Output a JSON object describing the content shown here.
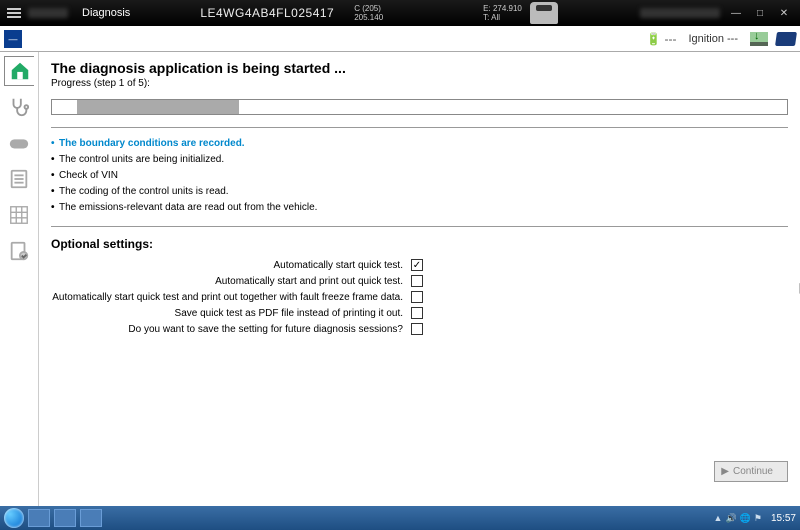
{
  "titlebar": {
    "app_name": "Diagnosis",
    "vin": "LE4WG4AB4FL025417",
    "col1a": "C (205)",
    "col1b": "205.140",
    "col2a": "E: 274.910",
    "col2b": "T: All",
    "min": "—",
    "max": "□",
    "close": "✕"
  },
  "toolbar": {
    "home": "—",
    "battery": "🔋 ---",
    "ignition": "Ignition ---"
  },
  "content": {
    "heading": "The diagnosis application is being started ...",
    "progress_label": "Progress (step 1 of 5):",
    "steps": [
      "The boundary conditions are recorded.",
      "The control units are being initialized.",
      "Check of VIN",
      "The coding of the control units is read.",
      "The emissions-relevant data are read out from the vehicle."
    ],
    "optional_heading": "Optional settings:",
    "options": [
      {
        "label": "Automatically start quick test.",
        "checked": true
      },
      {
        "label": "Automatically start and print out quick test.",
        "checked": false
      },
      {
        "label": "Automatically start quick test and print out together with fault freeze frame data.",
        "checked": false
      },
      {
        "label": "Save quick test as PDF file instead of printing it out.",
        "checked": false
      },
      {
        "label": "Do you want to save the setting for future diagnosis sessions?",
        "checked": false
      }
    ],
    "continue": "Continue"
  },
  "taskbar": {
    "clock": "15:57"
  }
}
